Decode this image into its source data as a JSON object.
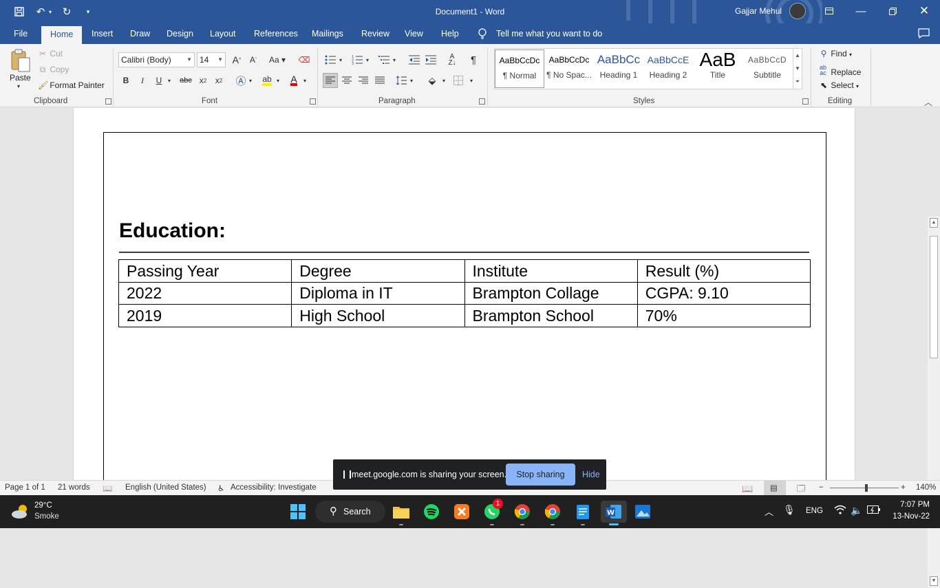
{
  "titlebar": {
    "document_title": "Document1  -  Word",
    "user_name": "Gajjar Mehul"
  },
  "menu": {
    "tabs": [
      "File",
      "Home",
      "Insert",
      "Draw",
      "Design",
      "Layout",
      "References",
      "Mailings",
      "Review",
      "View",
      "Help"
    ],
    "tell_me": "Tell me what you want to do"
  },
  "ribbon": {
    "clipboard": {
      "paste": "Paste",
      "cut": "Cut",
      "copy": "Copy",
      "format_painter": "Format Painter",
      "label": "Clipboard"
    },
    "font": {
      "family": "Calibri (Body)",
      "size": "14",
      "label": "Font"
    },
    "paragraph": {
      "label": "Paragraph"
    },
    "styles": {
      "label": "Styles",
      "items": [
        {
          "preview": "AaBbCcDc",
          "name": "¶ Normal"
        },
        {
          "preview": "AaBbCcDc",
          "name": "¶ No Spac..."
        },
        {
          "preview": "AaBbCc",
          "name": "Heading 1"
        },
        {
          "preview": "AaBbCcE",
          "name": "Heading 2"
        },
        {
          "preview": "AaB",
          "name": "Title"
        },
        {
          "preview": "AaBbCcD",
          "name": "Subtitle"
        }
      ]
    },
    "editing": {
      "find": "Find",
      "replace": "Replace",
      "select": "Select",
      "label": "Editing"
    }
  },
  "document": {
    "heading": "Education:",
    "table": {
      "rows": [
        [
          "Passing Year",
          "Degree",
          "Institute",
          "Result (%)"
        ],
        [
          "2022",
          "Diploma in IT",
          "Brampton Collage",
          "CGPA: 9.10"
        ],
        [
          "2019",
          "High School",
          "Brampton School",
          "70%"
        ]
      ]
    }
  },
  "status": {
    "page": "Page 1 of 1",
    "words": "21 words",
    "language": "English (United States)",
    "accessibility": "Accessibility: Investigate",
    "zoom": "140%"
  },
  "share_banner": {
    "text": "meet.google.com is sharing your screen.",
    "stop": "Stop sharing",
    "hide": "Hide"
  },
  "taskbar": {
    "weather_temp": "29°C",
    "weather_desc": "Smoke",
    "search": "Search",
    "whatsapp_badge": "1",
    "lang": "ENG",
    "time": "7:07 PM",
    "date": "13-Nov-22"
  },
  "colors": {
    "word_blue": "#2b579a",
    "ribbon_bg": "#f3f3f3",
    "taskbar_bg": "#202020",
    "meet_blue": "#8ab4f8"
  }
}
